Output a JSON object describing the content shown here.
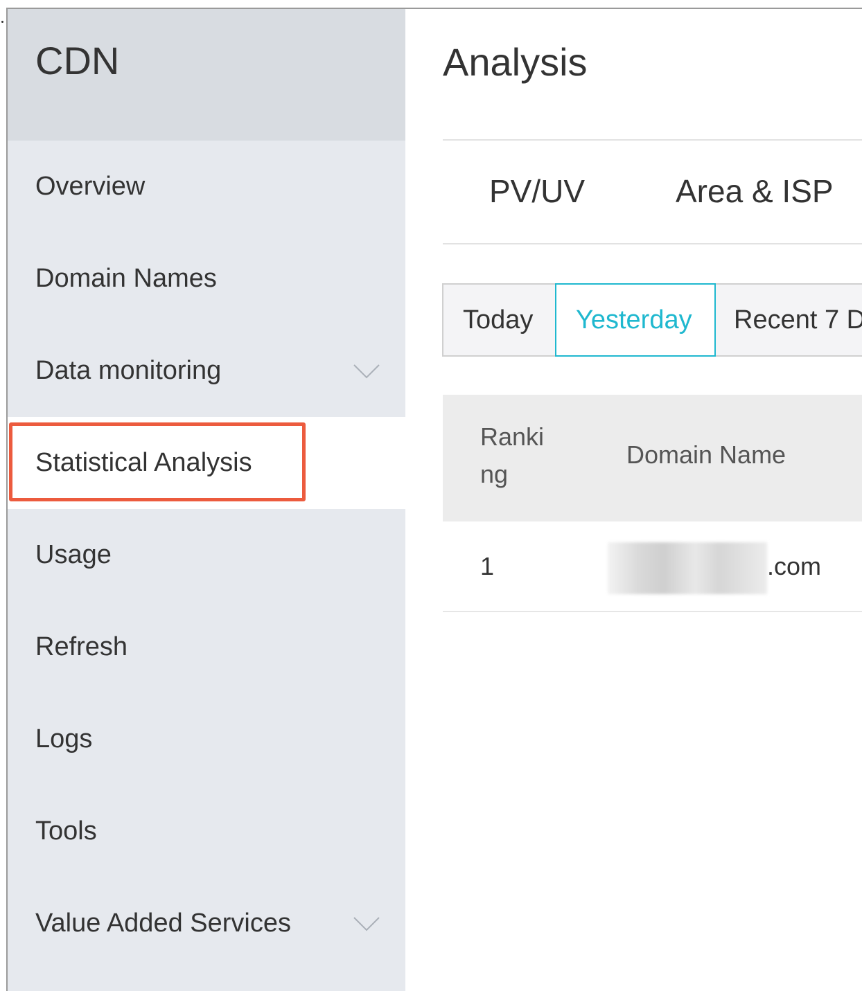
{
  "sidebar": {
    "title": "CDN",
    "items": [
      {
        "label": "Overview"
      },
      {
        "label": "Domain Names"
      },
      {
        "label": "Data monitoring"
      },
      {
        "label": "Statistical Analysis"
      },
      {
        "label": "Usage"
      },
      {
        "label": "Refresh"
      },
      {
        "label": "Logs"
      },
      {
        "label": "Tools"
      },
      {
        "label": "Value Added Services"
      }
    ],
    "active_item": "Statistical Analysis"
  },
  "main": {
    "title": "Analysis",
    "tabs": [
      {
        "label": "PV/UV"
      },
      {
        "label": "Area & ISP"
      }
    ],
    "time_range": {
      "options": [
        "Today",
        "Yesterday",
        "Recent 7 D"
      ],
      "selected": "Yesterday"
    },
    "table": {
      "headers": [
        "Ranki ng",
        "Domain Name"
      ],
      "header_line1": "Ranki",
      "header_line2": "ng",
      "rows": [
        {
          "ranking": "1",
          "domain_suffix": ".com"
        }
      ]
    }
  },
  "colors": {
    "accent": "#1fb8cf",
    "highlight": "#ec5b3e",
    "sidebar_bg": "#e6e9ee"
  }
}
